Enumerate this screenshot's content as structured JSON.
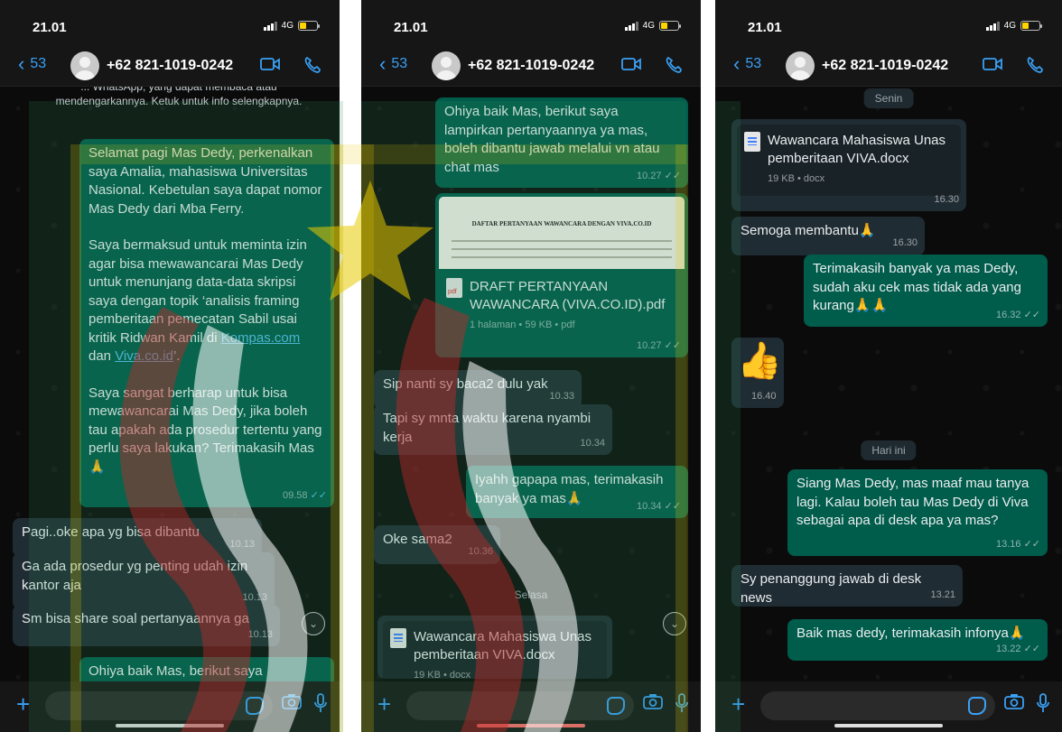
{
  "screens": [
    {
      "status": {
        "time": "21.01",
        "network": "4G"
      },
      "header": {
        "back_count": "53",
        "contact": "+62 821-1019-0242"
      },
      "system_note": "... WhatsApp, yang dapat membaca atau mendengarkannya. Ketuk untuk info selengkapnya.",
      "messages": [
        {
          "dir": "out",
          "p1": "Selamat pagi Mas Dedy, perkenalkan saya Amalia, mahasiswa Universitas Nasional. Kebetulan saya dapat nomor Mas Dedy dari Mba Ferry.",
          "p2_a": "Saya bermaksud untuk meminta izin agar bisa mewawancarai Mas Dedy untuk menunjang data-data skripsi saya dengan topik ‘analisis framing pemberitaan pemecatan Sabil usai kritik Ridwan Kamil di ",
          "p2_link1": "Kompas.com",
          "p2_mid": " dan ",
          "p2_link2": "Viva.co.id",
          "p2_end": "’.",
          "p3": "Saya sangat berharap untuk bisa mewawancarai Mas Dedy, jika boleh tau apakah ada prosedur tertentu yang perlu saya lakukan? Terimakasih Mas🙏",
          "time": "09.58"
        },
        {
          "dir": "in",
          "text": "Pagi..oke apa yg bisa dibantu",
          "time": "10.13"
        },
        {
          "dir": "in",
          "text": "Ga ada prosedur yg penting udah izin kantor aja",
          "time": "10.13"
        },
        {
          "dir": "in",
          "text": "Sm bisa share soal pertanyaannya ga",
          "time": "10.13"
        },
        {
          "dir": "out",
          "text": "Ohiya baik Mas, berikut saya"
        }
      ]
    },
    {
      "status": {
        "time": "21.01",
        "network": "4G"
      },
      "header": {
        "back_count": "53",
        "contact": "+62 821-1019-0242"
      },
      "messages": [
        {
          "dir": "out",
          "text": "Ohiya baik Mas, berikut saya lampirkan pertanyaannya ya mas, boleh dibantu jawab melalui vn atau chat mas",
          "time": "10.27"
        },
        {
          "dir": "out",
          "type": "pdf",
          "preview_title": "DAFTAR PERTANYAAN WAWANCARA DENGAN VIVA.CO.ID",
          "filename": "DRAFT PERTANYAAN WAWANCARA (VIVA.CO.ID).pdf",
          "meta": "1 halaman • 59 KB • pdf",
          "time": "10.27"
        },
        {
          "dir": "in",
          "text": "Sip nanti sy baca2 dulu yak",
          "time": "10.33"
        },
        {
          "dir": "in",
          "text": "Tapi sy mnta waktu karena nyambi kerja",
          "time": "10.34"
        },
        {
          "dir": "out",
          "text": "Iyahh gapapa mas, terimakasih banyak ya mas🙏",
          "time": "10.34"
        },
        {
          "dir": "in",
          "text": "Oke sama2",
          "time": "10.36"
        },
        {
          "date": "Selasa"
        },
        {
          "dir": "in",
          "type": "doc",
          "filename": "Wawancara Mahasiswa Unas pemberitaan VIVA.docx",
          "meta": "19 KB • docx"
        }
      ]
    },
    {
      "status": {
        "time": "21.01",
        "network": "4G"
      },
      "header": {
        "back_count": "53",
        "contact": "+62 821-1019-0242"
      },
      "messages": [
        {
          "date": "Senin"
        },
        {
          "dir": "in",
          "type": "doc",
          "filename": "Wawancara Mahasiswa Unas pemberitaan VIVA.docx",
          "meta": "19 KB • docx",
          "time": "16.30"
        },
        {
          "dir": "in",
          "text": "Semoga membantu🙏",
          "time": "16.30"
        },
        {
          "dir": "out",
          "text": "Terimakasih banyak ya mas Dedy, sudah aku cek mas tidak ada yang kurang🙏🙏",
          "time": "16.32"
        },
        {
          "dir": "in",
          "type": "emoji",
          "text": "👍",
          "time": "16.40"
        },
        {
          "date": "Hari ini"
        },
        {
          "dir": "out",
          "text": "Siang Mas Dedy, mas maaf mau tanya lagi. Kalau boleh tau Mas Dedy di Viva sebagai apa di desk apa ya mas?",
          "time": "13.16"
        },
        {
          "dir": "in",
          "text": "Sy penanggung jawab di desk news",
          "time": "13.21"
        },
        {
          "dir": "out",
          "text": "Baik mas dedy, terimakasih infonya🙏",
          "time": "13.22"
        }
      ]
    }
  ],
  "icons": [
    "back-chevron-icon",
    "video-call-icon",
    "phone-icon",
    "plus-icon",
    "sticker-icon",
    "camera-icon",
    "mic-icon",
    "scroll-down-icon",
    "read-ticks-icon"
  ],
  "colors": {
    "outgoing": "#005c4b",
    "incoming": "#202c33",
    "accent": "#3aa0f5",
    "watermark_green": "#2e8b57",
    "watermark_yellow": "#e8c800",
    "watermark_red": "#c0282a"
  }
}
